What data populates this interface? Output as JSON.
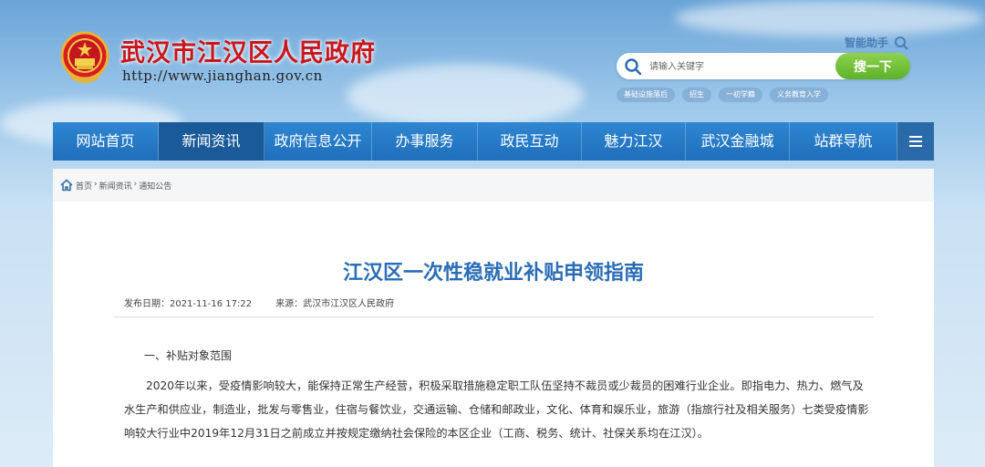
{
  "site": {
    "title": "武汉市江汉区人民政府",
    "url": "http://www.jianghan.gov.cn"
  },
  "assistant": {
    "label": "智能助手"
  },
  "search": {
    "placeholder": "请输入关键字",
    "button_label": "搜一下",
    "hot_tags": [
      "基础设施落后",
      "招生",
      "一初学籍",
      "义务教育入学"
    ]
  },
  "nav": {
    "items": [
      "网站首页",
      "新闻资讯",
      "政府信息公开",
      "办事服务",
      "政民互动",
      "魅力江汉",
      "武汉金融城",
      "站群导航"
    ],
    "active_index": 1,
    "menu_icon": "menu-icon"
  },
  "breadcrumb": [
    "首页",
    "›",
    "新闻资讯",
    "›",
    "通知公告"
  ],
  "article": {
    "title": "江汉区一次性稳就业补贴申领指南",
    "publish_date_label": "发布日期：",
    "publish_date": "2021-11-16 17:22",
    "source_label": "来源：",
    "source": "武汉市江汉区人民政府",
    "section_heading": "一、补贴对象范围",
    "paragraph": "2020年以来，受疫情影响较大，能保持正常生产经营，积极采取措施稳定职工队伍坚持不裁员或少裁员的困难行业企业。即指电力、热力、燃气及水生产和供应业，制造业，批发与零售业，住宿与餐饮业，交通运输、仓储和邮政业，文化、体育和娱乐业，旅游（指旅行社及相关服务）七类受疫情影响较大行业中2019年12月31日之前成立并按规定缴纳社会保险的本区企业（工商、税务、统计、社保关系均在江汉）。"
  },
  "colors": {
    "title_red": "#c8161d",
    "nav_blue": "#2f86d1",
    "nav_active": "#1a5a98",
    "search_green": "#5cb22a",
    "article_title_blue": "#2a6db5"
  }
}
